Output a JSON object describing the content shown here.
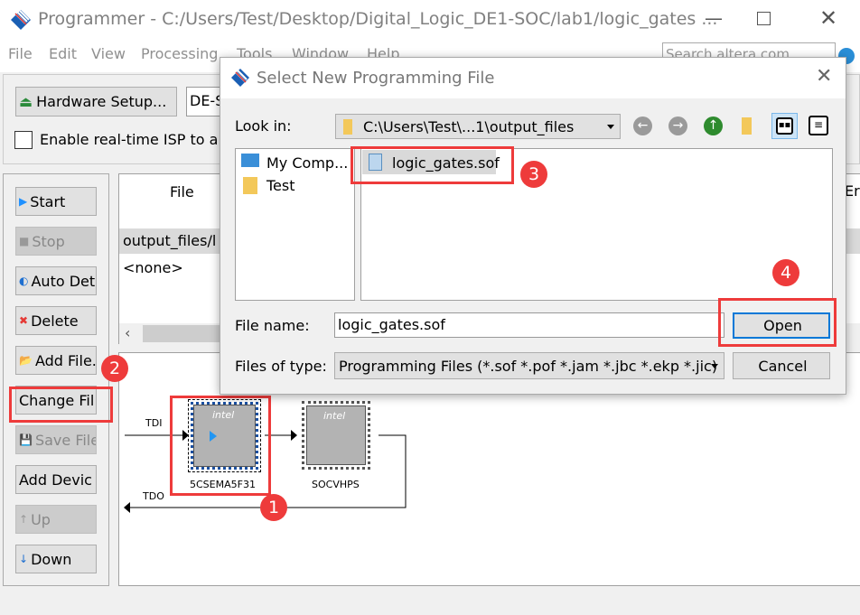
{
  "window": {
    "title": "Programmer - C:/Users/Test/Desktop/Digital_Logic_DE1-SOC/lab1/logic_gates ...",
    "menu": [
      "File",
      "Edit",
      "View",
      "Processing",
      "Tools",
      "Window",
      "Help"
    ],
    "search_placeholder": "Search altera.com"
  },
  "toolbar": {
    "hardware_setup": "Hardware Setup...",
    "hardware_value": "DE-S",
    "isp_label": "Enable real-time ISP to a",
    "isp_checked": false
  },
  "side_buttons": [
    {
      "label": "Start",
      "enabled": true
    },
    {
      "label": "Stop",
      "enabled": false
    },
    {
      "label": "Auto Dete",
      "enabled": true
    },
    {
      "label": "Delete",
      "enabled": true
    },
    {
      "label": "Add File.",
      "enabled": true
    },
    {
      "label": "Change Fil",
      "enabled": true
    },
    {
      "label": "Save File",
      "enabled": false
    },
    {
      "label": "Add Devic",
      "enabled": true
    },
    {
      "label": "Up",
      "enabled": false
    },
    {
      "label": "Down",
      "enabled": true
    }
  ],
  "table": {
    "header": "File",
    "header_right": "Er",
    "rows": [
      "output_files/l",
      "<none>"
    ]
  },
  "chain": {
    "tdi": "TDI",
    "tdo": "TDO",
    "devices": [
      "5CSEMA5F31",
      "SOCVHPS"
    ],
    "chip_logo": "intel"
  },
  "dialog": {
    "title": "Select New Programming File",
    "look_in_label": "Look in:",
    "look_in_value": "C:\\Users\\Test\\...1\\output_files",
    "places": [
      "My Comp...",
      "Test"
    ],
    "files": [
      "logic_gates.sof"
    ],
    "file_name_label": "File name:",
    "file_name_value": "logic_gates.sof",
    "file_type_label": "Files of type:",
    "file_type_value": "Programming Files (*.sof *.pof *.jam *.jbc *.ekp *.jic)",
    "open": "Open",
    "cancel": "Cancel"
  },
  "annotations": [
    "1",
    "2",
    "3",
    "4"
  ],
  "colors": {
    "highlight": "#ee3b3b",
    "focus": "#0078d7"
  }
}
